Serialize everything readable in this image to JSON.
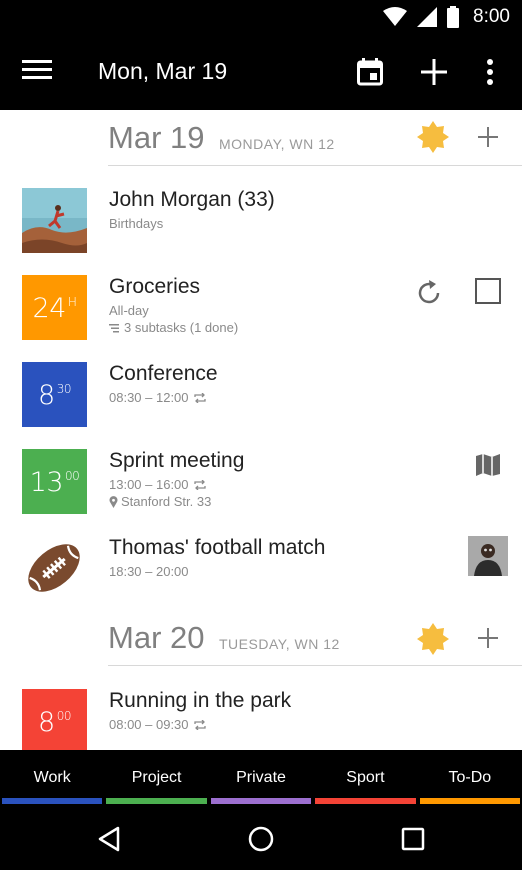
{
  "status": {
    "time": "8:00",
    "icons": [
      "wifi-icon",
      "signal-icon",
      "battery-icon"
    ]
  },
  "appbar": {
    "title": "Mon, Mar 19",
    "icons": [
      "menu-icon",
      "calendar-today-icon",
      "add-icon",
      "more-vert-icon"
    ]
  },
  "days": [
    {
      "date": "Mar 19",
      "sub": "MONDAY, WN 12",
      "weather_icon": "sun-icon",
      "add_icon": "add-icon",
      "events": [
        {
          "title": "John Morgan (33)",
          "line1": "Birthdays",
          "tile_type": "photo"
        },
        {
          "title": "Groceries",
          "line1": "All-day",
          "line2": "3 subtasks (1 done)",
          "tile_big": "24",
          "tile_sup": "H",
          "tile_color": "#ff9800",
          "side_icons": [
            "refresh-icon",
            "checkbox-icon"
          ]
        },
        {
          "title": "Conference",
          "line1": "08:30 – 12:00",
          "tile_big": "8",
          "tile_sup": "30",
          "tile_color": "#2a52be",
          "line1_icon": "repeat-icon"
        },
        {
          "title": "Sprint meeting",
          "line1": "13:00 – 16:00",
          "line2": "Stanford Str. 33",
          "tile_big": "13",
          "tile_sup": "00",
          "tile_color": "#4caf50",
          "line1_icon": "repeat-icon",
          "line2_icon": "location-pin-icon",
          "side_icons": [
            "map-icon"
          ]
        },
        {
          "title": "Thomas' football match",
          "line1": "18:30 – 20:00",
          "tile_type": "football-icon",
          "side_icons": [
            "attendee-photo"
          ]
        }
      ]
    },
    {
      "date": "Mar 20",
      "sub": "TUESDAY, WN 12",
      "weather_icon": "sun-icon",
      "add_icon": "add-icon",
      "events": [
        {
          "title": "Running in the park",
          "line1": "08:00 – 09:30",
          "tile_big": "8",
          "tile_sup": "00",
          "tile_color": "#f44336",
          "line1_icon": "repeat-icon"
        }
      ]
    }
  ],
  "categories": [
    {
      "label": "Work",
      "color": "#2a52be"
    },
    {
      "label": "Project",
      "color": "#4caf50"
    },
    {
      "label": "Private",
      "color": "#9c6fcf"
    },
    {
      "label": "Sport",
      "color": "#f44336"
    },
    {
      "label": "To-Do",
      "color": "#ff9800"
    }
  ],
  "navbar": {
    "icons": [
      "back-icon",
      "home-icon",
      "recents-icon"
    ]
  }
}
